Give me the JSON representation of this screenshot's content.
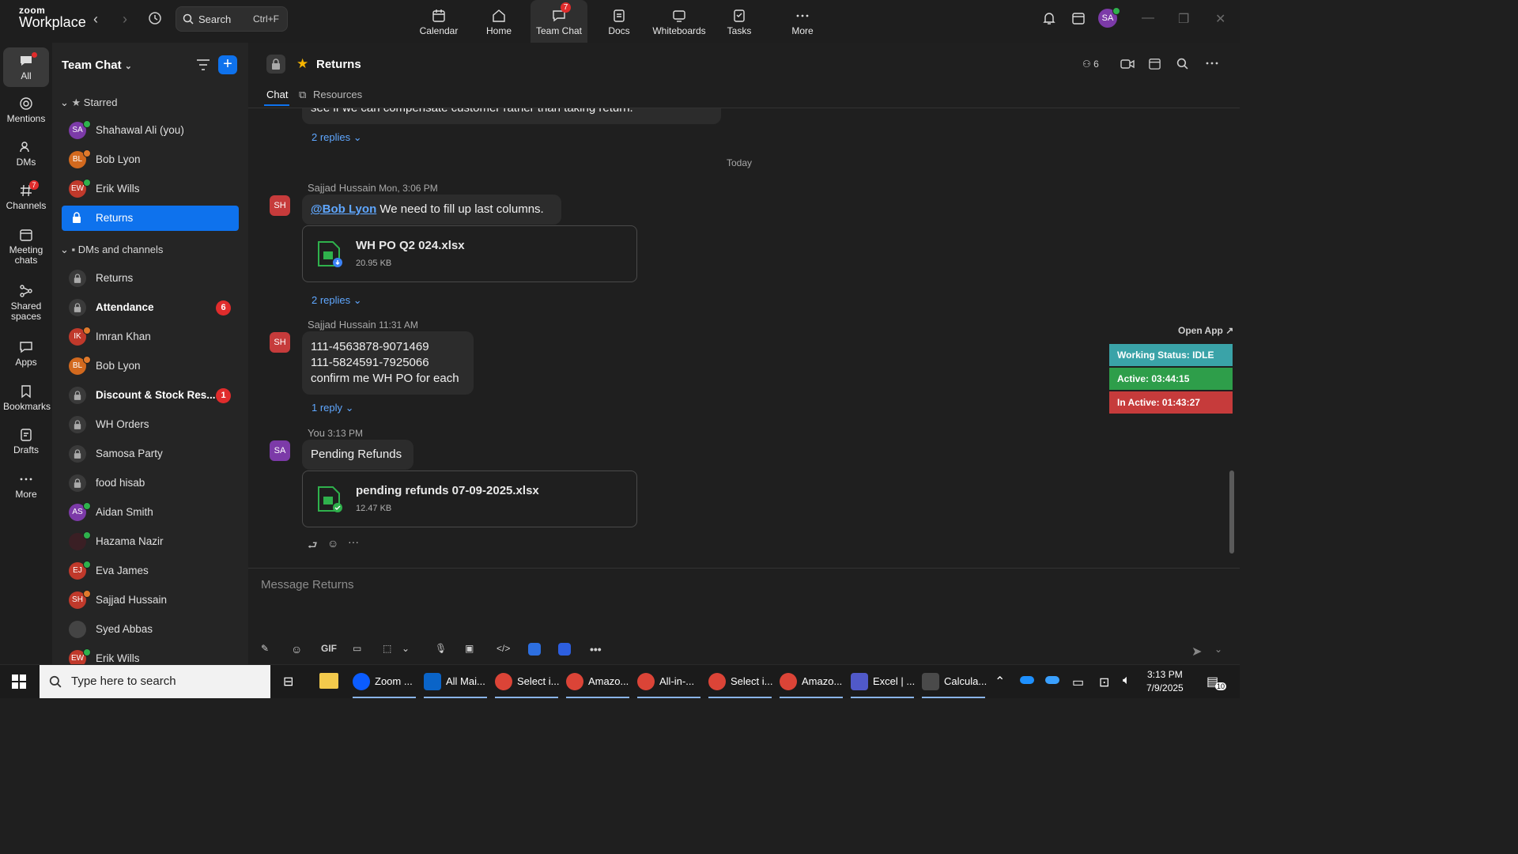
{
  "app": {
    "logo_top": "zoom",
    "logo_bottom": "Workplace"
  },
  "search": {
    "placeholder": "Search",
    "shortcut": "Ctrl+F"
  },
  "topnav": [
    {
      "label": "Calendar",
      "icon": "calendar-icon"
    },
    {
      "label": "Home",
      "icon": "home-icon"
    },
    {
      "label": "Team Chat",
      "icon": "chat-icon",
      "badge": "7",
      "active": true
    },
    {
      "label": "Docs",
      "icon": "docs-icon"
    },
    {
      "label": "Whiteboards",
      "icon": "whiteboard-icon"
    },
    {
      "label": "Tasks",
      "icon": "tasks-icon"
    },
    {
      "label": "More",
      "icon": "more-icon"
    }
  ],
  "user_avatar": "SA",
  "rail": [
    {
      "label": "All",
      "active": true
    },
    {
      "label": "Mentions"
    },
    {
      "label": "DMs"
    },
    {
      "label": "Channels",
      "badge": "7"
    },
    {
      "label": "Meeting chats"
    },
    {
      "label": "Shared spaces"
    },
    {
      "label": "Apps"
    },
    {
      "label": "Bookmarks"
    },
    {
      "label": "Drafts"
    },
    {
      "label": "More"
    }
  ],
  "sidebar": {
    "title": "Team Chat",
    "starred_label": "Starred",
    "starred": [
      {
        "name": "Shahawal Ali (you)",
        "initials": "SA",
        "color": "#7c3aa8"
      },
      {
        "name": "Bob Lyon",
        "initials": "BL",
        "color": "#d2691e"
      },
      {
        "name": "Erik Wills",
        "initials": "EW",
        "color": "#c0392b"
      },
      {
        "name": "Returns",
        "lock": true,
        "selected": true
      }
    ],
    "dms_label": "DMs and channels",
    "dms": [
      {
        "name": "Returns",
        "lock": true
      },
      {
        "name": "Attendance",
        "lock": true,
        "bold": true,
        "count": "6"
      },
      {
        "name": "Imran Khan",
        "initials": "IK",
        "color": "#c0392b"
      },
      {
        "name": "Bob Lyon",
        "initials": "BL",
        "color": "#d2691e"
      },
      {
        "name": "Discount & Stock Res...",
        "lock": true,
        "bold": true,
        "count": "1"
      },
      {
        "name": "WH Orders",
        "lock": true
      },
      {
        "name": "Samosa Party",
        "lock": true
      },
      {
        "name": "food hisab",
        "lock": true
      },
      {
        "name": "Aidan Smith",
        "initials": "AS",
        "color": "#7c3aa8"
      },
      {
        "name": "Hazama Nazir",
        "initials": "",
        "color": "#3a1f24"
      },
      {
        "name": "Eva James",
        "initials": "EJ",
        "color": "#c0392b"
      },
      {
        "name": "Sajjad Hussain",
        "initials": "SH",
        "color": "#c0392b"
      },
      {
        "name": "Syed Abbas",
        "initials": "",
        "color": "#444"
      },
      {
        "name": "Erik Wills",
        "initials": "EW",
        "color": "#c0392b"
      }
    ]
  },
  "channel": {
    "title": "Returns",
    "tabs": [
      "Chat",
      "Resources"
    ],
    "members": "6"
  },
  "messages": {
    "prev_text": "see if we can compensate customer rather than taking return.",
    "prev_replies": "2 replies",
    "day_divider": "Today",
    "m1": {
      "sender": "Sajjad Hussain",
      "time": "Mon, 3:06 PM",
      "initials": "SH",
      "mention": "@Bob Lyon",
      "text": " We need to fill up last columns.",
      "file_name": "WH PO Q2 024.xlsx",
      "file_size": "20.95 KB",
      "replies": "2 replies"
    },
    "m2": {
      "sender": "Sajjad Hussain",
      "time": "11:31 AM",
      "initials": "SH",
      "line1": "111-4563878-9071469",
      "line2": "111-5824591-7925066",
      "line3": "confirm me WH PO for each",
      "replies": "1 reply"
    },
    "m3": {
      "sender": "You",
      "time": "3:13 PM",
      "initials": "SA",
      "text": "Pending Refunds",
      "file_name": "pending refunds 07-09-2025.xlsx",
      "file_size": "12.47 KB"
    }
  },
  "composer": {
    "placeholder": "Message Returns",
    "gif": "GIF"
  },
  "status_widget": {
    "open_app": "Open App ↗",
    "working": "Working Status: IDLE",
    "active": "Active: 03:44:15",
    "inactive": "In Active: 01:43:27",
    "colors": {
      "working": "#3aa3a8",
      "active": "#2e9e4a",
      "inactive": "#c63b3b"
    }
  },
  "taskbar": {
    "search_placeholder": "Type here to search",
    "apps": [
      "Zoom ...",
      "All Mai...",
      "Select i...",
      "Amazo...",
      "All-in-...",
      "Select i...",
      "Amazo...",
      "Excel | ...",
      "Calcula..."
    ],
    "time": "3:13 PM",
    "date": "7/9/2025",
    "notif": "10"
  }
}
